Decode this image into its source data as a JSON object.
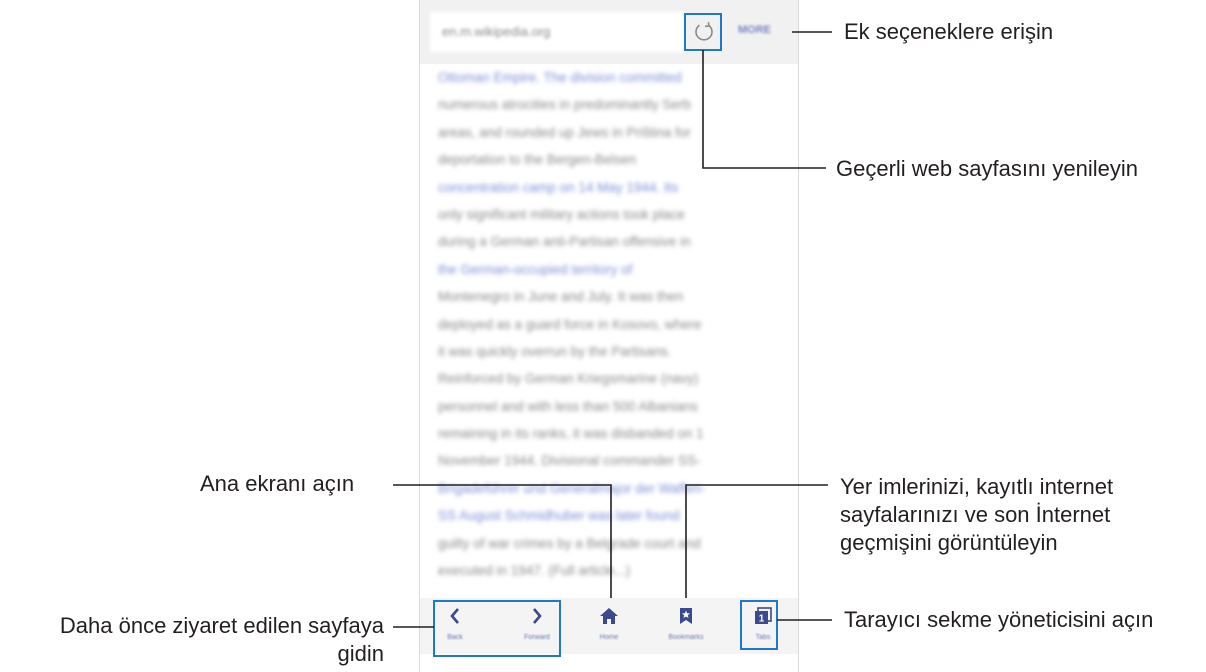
{
  "browser": {
    "url": "en.m.wikipedia.org",
    "more_label": "MORE",
    "article_lines": [
      {
        "text": "Ottoman Empire. The division committed",
        "link": true
      },
      {
        "text": "numerous atrocities in predominantly Serb",
        "link": false
      },
      {
        "text": "areas, and rounded up Jews in Priština for",
        "link": false
      },
      {
        "text": "deportation to the Bergen-Belsen",
        "link": false
      },
      {
        "text": "concentration camp on 14 May 1944. Its",
        "link": true
      },
      {
        "text": "only significant military actions took place",
        "link": false
      },
      {
        "text": "during a German anti-Partisan offensive in",
        "link": false
      },
      {
        "text": "the German-occupied territory of",
        "link": true
      },
      {
        "text": "Montenegro in June and July. It was then",
        "link": false
      },
      {
        "text": "deployed as a guard force in Kosovo, where",
        "link": false
      },
      {
        "text": "it was quickly overrun by the Partisans.",
        "link": false
      },
      {
        "text": "Reinforced by German Kriegsmarine (navy)",
        "link": false
      },
      {
        "text": "personnel and with less than 500 Albanians",
        "link": false
      },
      {
        "text": "remaining in its ranks, it was disbanded on 1",
        "link": false
      },
      {
        "text": "November 1944. Divisional commander SS-",
        "link": false
      },
      {
        "text": "Brigadeführer und Generalmajor der Waffen-",
        "link": true
      },
      {
        "text": "SS August Schmidhuber was later found",
        "link": true
      },
      {
        "text": "guilty of war crimes by a Belgrade court and",
        "link": false
      },
      {
        "text": "executed in 1947. (Full article...)",
        "link": false
      }
    ],
    "nav": {
      "back": "Back",
      "forward": "Forward",
      "home": "Home",
      "bookmarks": "Bookmarks",
      "tabs": "Tabs",
      "tab_count": "1"
    },
    "colors": {
      "accent": "#3a4a8c",
      "callout_line": "#1f78c8"
    }
  },
  "callouts": {
    "more": "Ek seçeneklere erişin",
    "refresh": "Geçerli web sayfasını yenileyin",
    "home": "Ana ekranı açın",
    "bookmarks_line1": "Yer imlerinizi, kayıtlı internet",
    "bookmarks_line2": "sayfalarınızı ve son İnternet",
    "bookmarks_line3": "geçmişini görüntüleyin",
    "back_forward_line1": "Daha önce ziyaret edilen sayfaya",
    "back_forward_line2": "gidin",
    "tabs": "Tarayıcı sekme yöneticisini açın"
  }
}
